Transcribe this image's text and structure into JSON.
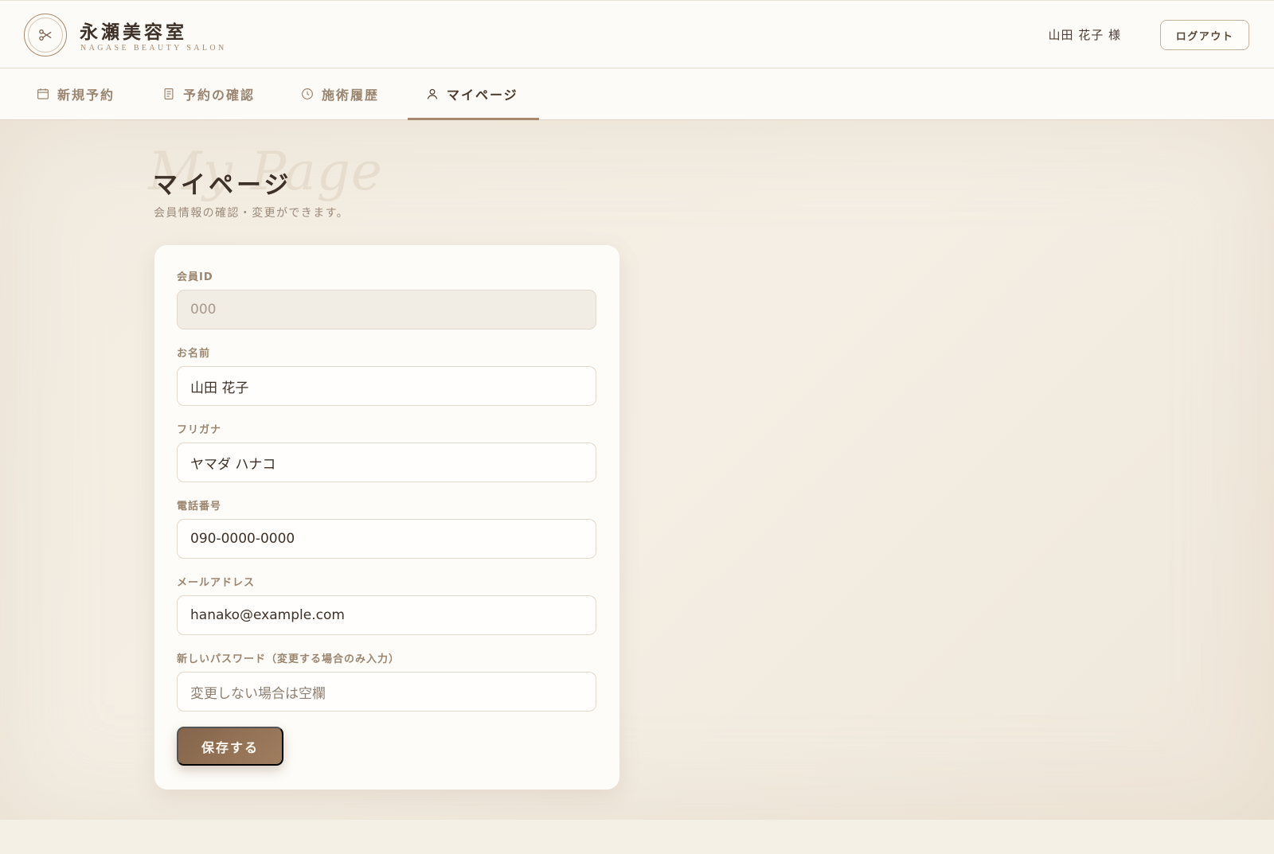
{
  "header": {
    "brand_title": "永瀬美容室",
    "brand_subtitle": "NAGASE BEAUTY SALON",
    "logo_icon": "scissors-icon",
    "user_name": "山田 花子 様",
    "logout_label": "ログアウト"
  },
  "nav": {
    "tabs": [
      {
        "label": "新規予約",
        "icon": "calendar-icon",
        "active": false
      },
      {
        "label": "予約の確認",
        "icon": "document-icon",
        "active": false
      },
      {
        "label": "施術履歴",
        "icon": "clock-icon",
        "active": false
      },
      {
        "label": "マイページ",
        "icon": "user-icon",
        "active": true
      }
    ]
  },
  "page": {
    "watermark": "My Page",
    "title": "マイページ",
    "description": "会員情報の確認・変更ができます。"
  },
  "form": {
    "member_id": {
      "label": "会員ID",
      "value": "000"
    },
    "name": {
      "label": "お名前",
      "value": "山田 花子"
    },
    "furigana": {
      "label": "フリガナ",
      "value": "ヤマダ ハナコ"
    },
    "phone": {
      "label": "電話番号",
      "value": "090-0000-0000"
    },
    "email": {
      "label": "メールアドレス",
      "value": "hanako@example.com"
    },
    "password": {
      "label": "新しいパスワード（変更する場合のみ入力）",
      "value": "",
      "placeholder": "変更しない場合は空欄"
    },
    "save_label": "保存する"
  },
  "colors": {
    "accent": "#a8896d",
    "button": "#8d6c51",
    "background": "#f4efe6"
  }
}
